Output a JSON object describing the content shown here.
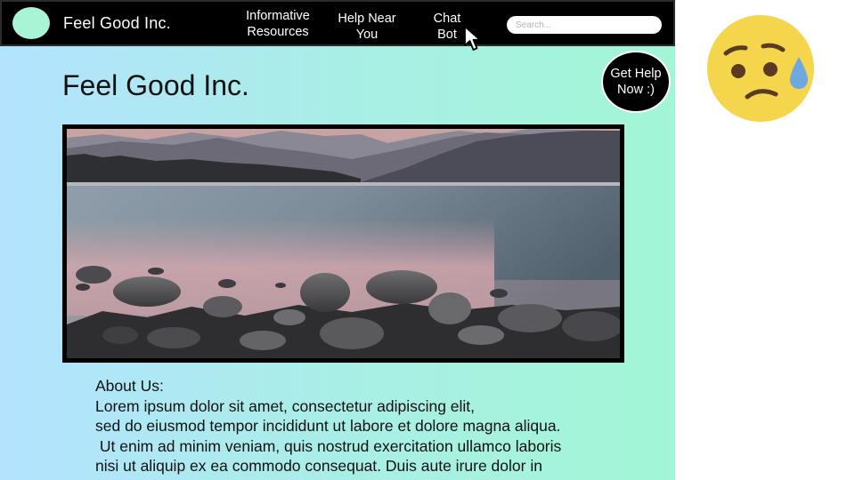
{
  "navbar": {
    "brand": "Feel Good Inc.",
    "links": [
      {
        "label": "Informative\nResources"
      },
      {
        "label": "Help Near\nYou"
      },
      {
        "label": "Chat\nBot"
      }
    ],
    "search": {
      "placeholder": "Search..."
    }
  },
  "help_button": {
    "label": "Get Help\nNow :)"
  },
  "main": {
    "title": "Feel Good Inc.",
    "about": {
      "heading": "About Us:",
      "lines": [
        "Lorem ipsum dolor sit amet, consectetur adipiscing elit,",
        "sed do eiusmod tempor incididunt ut labore et dolore magna aliqua.",
        " Ut enim ad minim veniam, quis nostrud exercitation ullamco laboris",
        "nisi ut aliquip ex ea commodo consequat. Duis aute irure dolor in"
      ]
    }
  },
  "icons": {
    "logo": "logo-circle",
    "cursor": "mouse-pointer-icon",
    "emoji": "sad-sweat-face-icon"
  },
  "colors": {
    "navbar": "#000000",
    "logo": "#a8f4d4",
    "gradient_start": "#b3e3ff",
    "gradient_end": "#a2f6d6",
    "emoji_face": "#f5d54b",
    "sweat_drop": "#6ea8e0"
  }
}
